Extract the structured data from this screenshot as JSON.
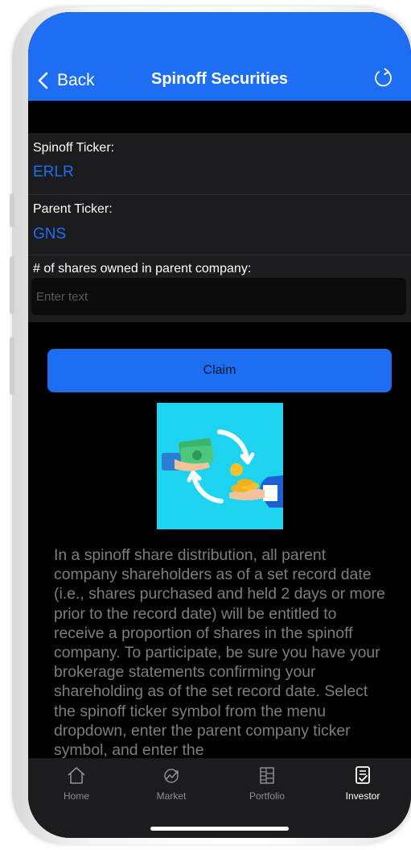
{
  "nav": {
    "back_label": "Back",
    "title": "Spinoff Securities"
  },
  "form": {
    "spinoff_ticker_label": "Spinoff Ticker:",
    "spinoff_ticker_value": "ERLR",
    "parent_ticker_label": "Parent Ticker:",
    "parent_ticker_value": "GNS",
    "shares_label": "# of shares owned in parent company:",
    "shares_placeholder": "Enter text",
    "shares_value": ""
  },
  "claim_label": "Claim",
  "description": "In a spinoff share distribution, all parent company shareholders as of a set record date (i.e., shares purchased and held 2 days or more prior to the record date) will be entitled to receive a proportion of shares in the spinoff company. To participate, be sure you have your brokerage statements confirming your shareholding as of the set record date. Select the spinoff ticker symbol from the menu dropdown, enter the parent company ticker symbol, and enter the",
  "tabs": [
    {
      "label": "Home",
      "icon": "home-icon",
      "active": false
    },
    {
      "label": "Market",
      "icon": "market-chart-icon",
      "active": false
    },
    {
      "label": "Portfolio",
      "icon": "portfolio-icon",
      "active": false
    },
    {
      "label": "Investor",
      "icon": "investor-document-icon",
      "active": true
    }
  ],
  "colors": {
    "accent": "#1d6ef2",
    "background": "#000000",
    "row_background": "#1c1c1e",
    "illustration_background": "#1ed3f0"
  }
}
